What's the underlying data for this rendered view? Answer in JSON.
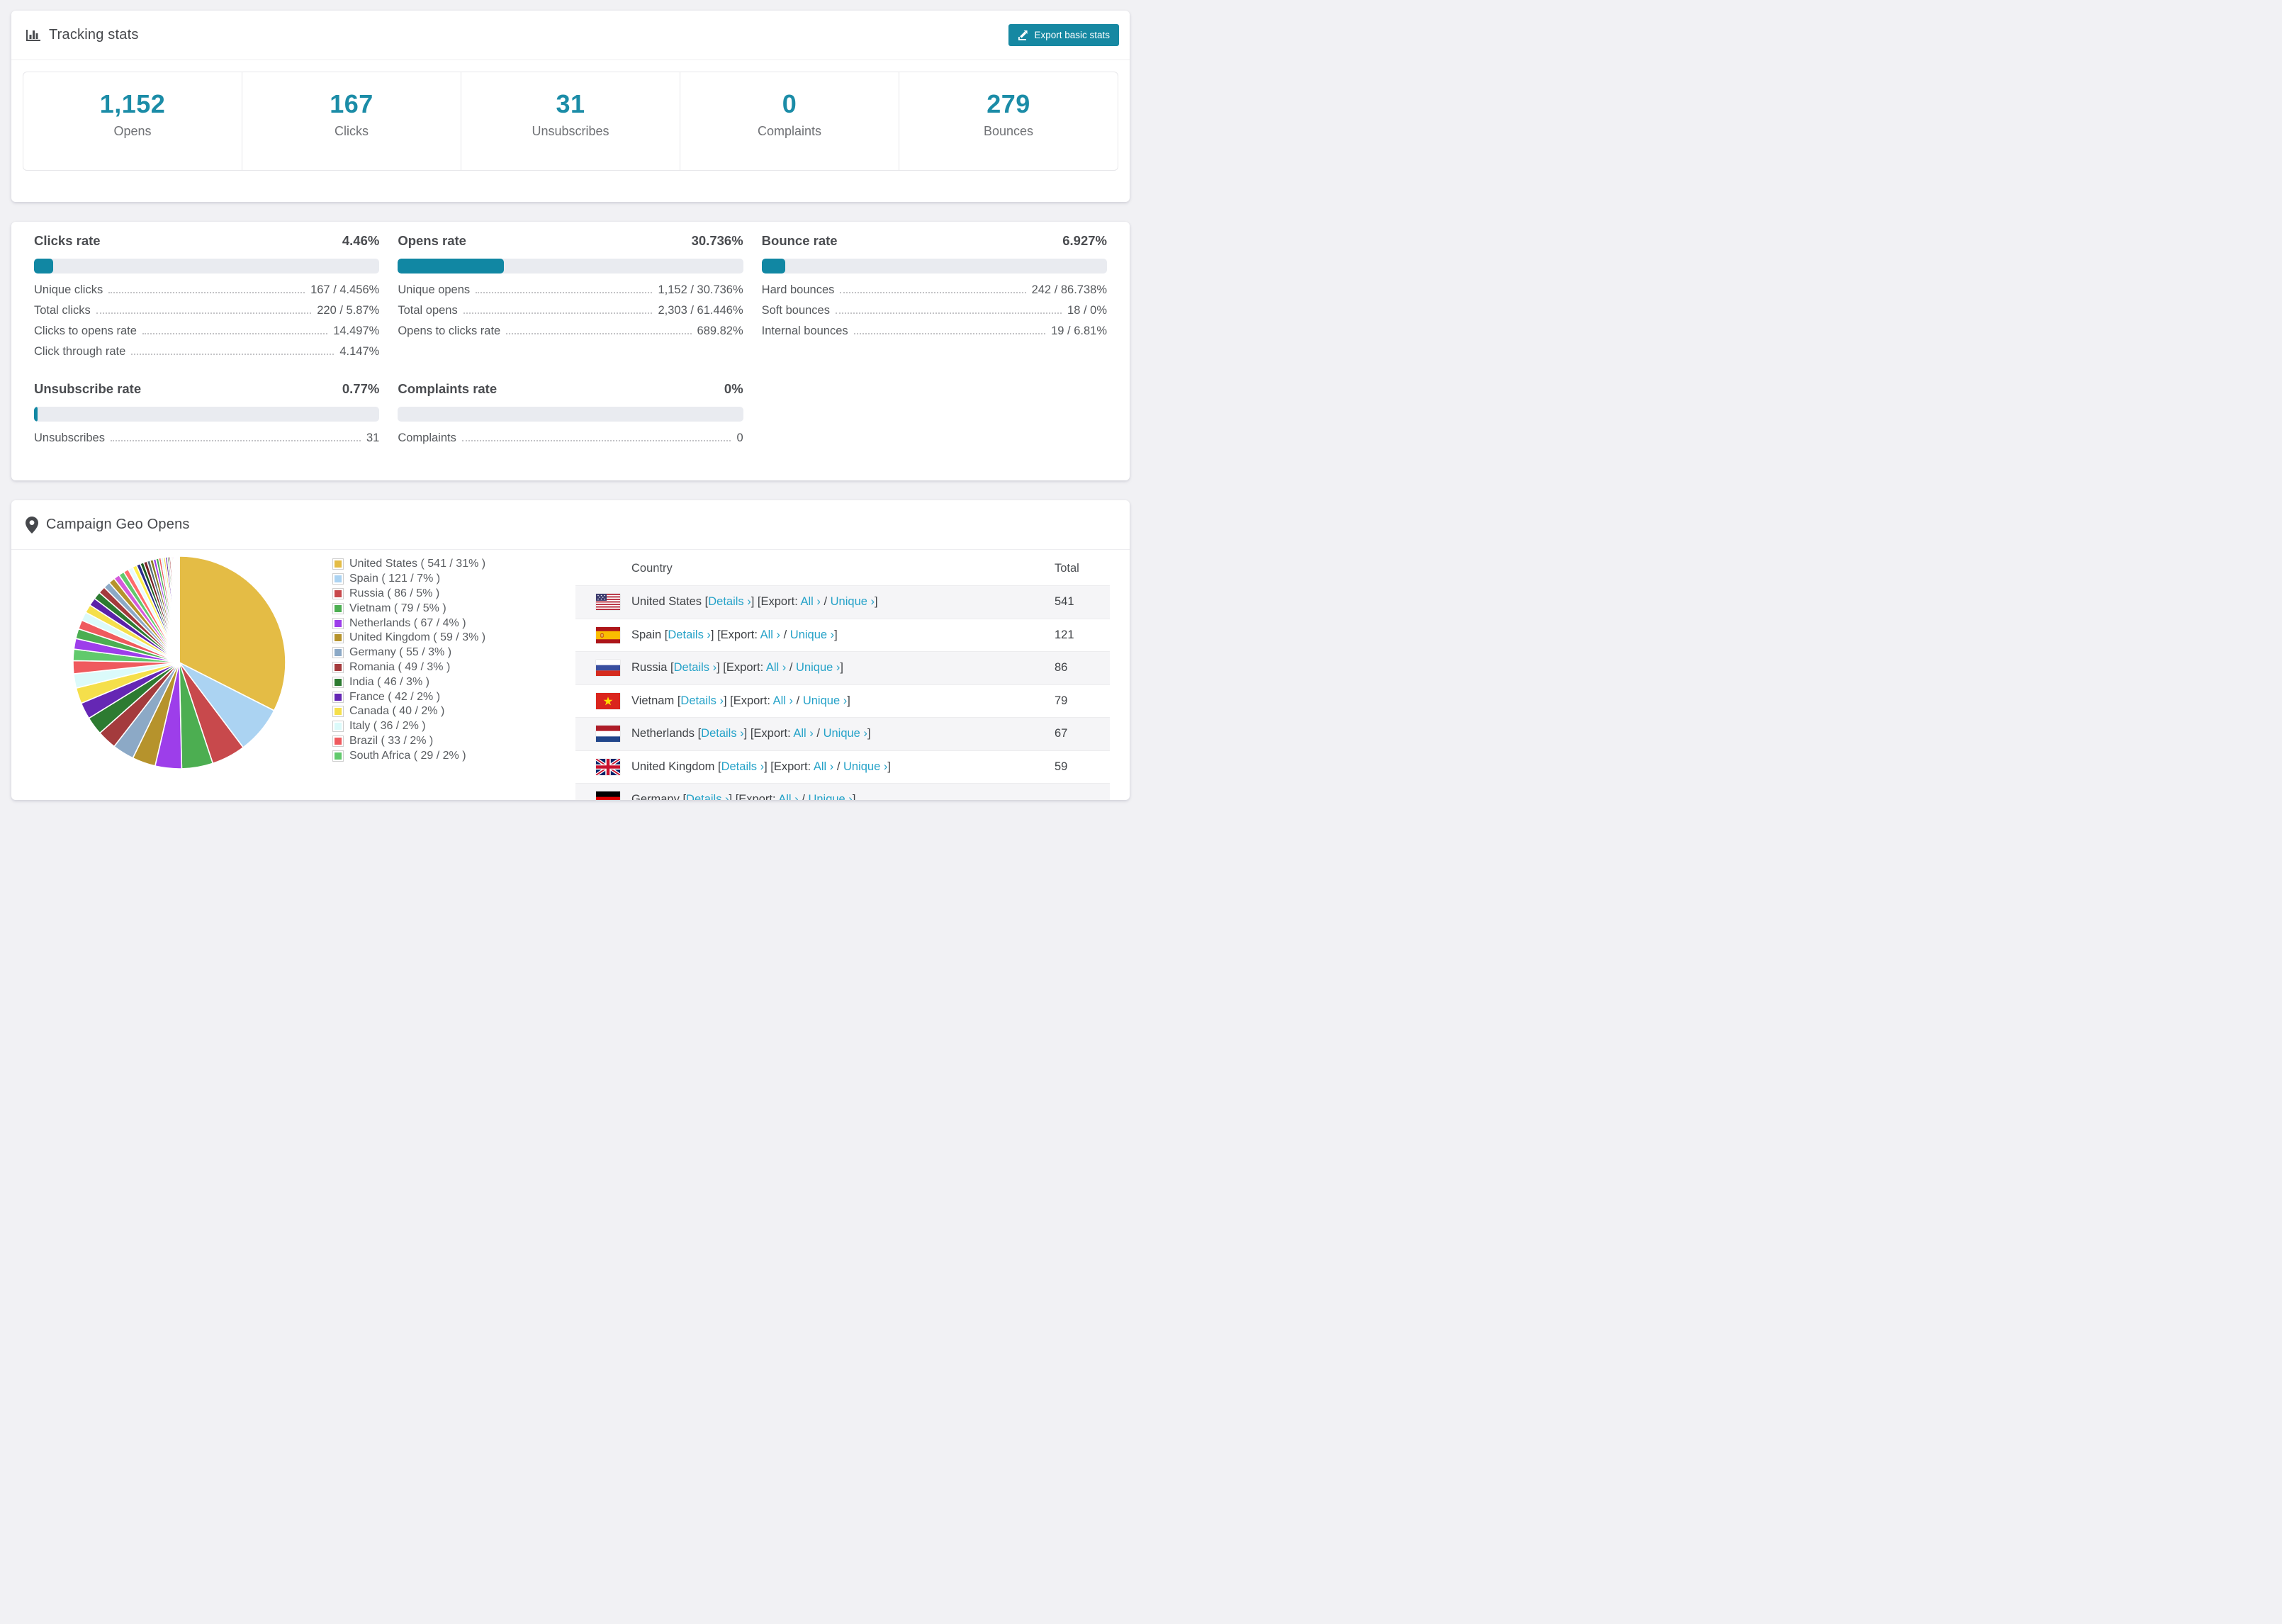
{
  "colors": {
    "accent_teal": "#1688a2",
    "stat_number_teal": "#1b8ca7",
    "link_teal": "#25a2c8",
    "bar_track": "#e9ebf0",
    "page_bg": "#f1f1f4",
    "zebra_row": "#f5f5f7"
  },
  "tracking": {
    "title": "Tracking stats",
    "export_label": "Export basic stats",
    "summary": [
      {
        "value": "1,152",
        "label": "Opens"
      },
      {
        "value": "167",
        "label": "Clicks"
      },
      {
        "value": "31",
        "label": "Unsubscribes"
      },
      {
        "value": "0",
        "label": "Complaints"
      },
      {
        "value": "279",
        "label": "Bounces"
      }
    ]
  },
  "rates": [
    {
      "title": "Clicks rate",
      "value": "4.46%",
      "fill_pct": 5.6,
      "rows": [
        {
          "label": "Unique clicks",
          "value": "167 / 4.456%"
        },
        {
          "label": "Total clicks",
          "value": "220 / 5.87%"
        },
        {
          "label": "Clicks to opens rate",
          "value": "14.497%"
        },
        {
          "label": "Click through rate",
          "value": "4.147%"
        }
      ]
    },
    {
      "title": "Opens rate",
      "value": "30.736%",
      "fill_pct": 30.7,
      "rows": [
        {
          "label": "Unique opens",
          "value": "1,152 / 30.736%"
        },
        {
          "label": "Total opens",
          "value": "2,303 / 61.446%"
        },
        {
          "label": "Opens to clicks rate",
          "value": "689.82%"
        }
      ]
    },
    {
      "title": "Bounce rate",
      "value": "6.927%",
      "fill_pct": 6.9,
      "rows": [
        {
          "label": "Hard bounces",
          "value": "242 / 86.738%"
        },
        {
          "label": "Soft bounces",
          "value": "18 / 0%"
        },
        {
          "label": "Internal bounces",
          "value": "19 / 6.81%"
        }
      ]
    },
    {
      "title": "Unsubscribe rate",
      "value": "0.77%",
      "fill_pct": 0.9,
      "rows": [
        {
          "label": "Unsubscribes",
          "value": "31"
        }
      ]
    },
    {
      "title": "Complaints rate",
      "value": "0%",
      "fill_pct": 0,
      "rows": [
        {
          "label": "Complaints",
          "value": "0"
        }
      ]
    }
  ],
  "geo": {
    "title": "Campaign Geo Opens",
    "table": {
      "col_country": "Country",
      "col_total": "Total",
      "details_label": "Details ›",
      "export_prefix": "[Export:",
      "all_label": "All ›",
      "slash": "/",
      "unique_label": "Unique ›",
      "open_bracket": "[",
      "close_bracket": "]",
      "rows": [
        {
          "country": "United States",
          "flag": "us",
          "total": "541"
        },
        {
          "country": "Spain",
          "flag": "es",
          "total": "121"
        },
        {
          "country": "Russia",
          "flag": "ru",
          "total": "86"
        },
        {
          "country": "Vietnam",
          "flag": "vn",
          "total": "79"
        },
        {
          "country": "Netherlands",
          "flag": "nl",
          "total": "67"
        },
        {
          "country": "United Kingdom",
          "flag": "gb",
          "total": "59"
        },
        {
          "country": "Germany",
          "flag": "de",
          "total": ""
        }
      ]
    }
  },
  "chart_data": {
    "type": "pie",
    "title": "Campaign Geo Opens",
    "legend_position": "right",
    "start_angle_deg": -90,
    "direction": "clockwise",
    "slices": [
      {
        "label": "United States",
        "value": 541,
        "pct": "31%",
        "color": "#E4BC45"
      },
      {
        "label": "Spain",
        "value": 121,
        "pct": "7%",
        "color": "#ABD3F2"
      },
      {
        "label": "Russia",
        "value": 86,
        "pct": "5%",
        "color": "#C8494C"
      },
      {
        "label": "Vietnam",
        "value": 79,
        "pct": "5%",
        "color": "#4CAE51"
      },
      {
        "label": "Netherlands",
        "value": 67,
        "pct": "4%",
        "color": "#9D3EEA"
      },
      {
        "label": "United Kingdom",
        "value": 59,
        "pct": "3%",
        "color": "#B6932C"
      },
      {
        "label": "Germany",
        "value": 55,
        "pct": "3%",
        "color": "#8CA9C6"
      },
      {
        "label": "Romania",
        "value": 49,
        "pct": "3%",
        "color": "#A43B3D"
      },
      {
        "label": "India",
        "value": 46,
        "pct": "3%",
        "color": "#2D7B31"
      },
      {
        "label": "France",
        "value": 42,
        "pct": "2%",
        "color": "#6527B4"
      },
      {
        "label": "Canada",
        "value": 40,
        "pct": "2%",
        "color": "#F5DF4B"
      },
      {
        "label": "Italy",
        "value": 36,
        "pct": "2%",
        "color": "#DBFAFA"
      },
      {
        "label": "Brazil",
        "value": 33,
        "pct": "2%",
        "color": "#EF5A5E"
      },
      {
        "label": "South Africa",
        "value": 29,
        "pct": "2%",
        "color": "#61C96C"
      }
    ],
    "others_values": [
      27,
      25,
      23,
      22,
      21,
      20,
      19,
      18,
      17,
      16,
      15,
      14,
      13,
      12,
      11,
      10,
      9,
      9,
      8,
      8,
      7,
      7,
      6,
      6,
      5,
      5,
      4,
      4,
      3,
      3,
      3,
      2,
      2,
      2,
      2,
      1,
      1,
      1,
      1,
      1
    ],
    "others_palette": [
      "#9D3EEA",
      "#4CAE51",
      "#EF5A5E",
      "#DBFAFA",
      "#F5DF4B",
      "#5B21A8",
      "#2D7B31",
      "#A43B3D",
      "#8CA9C6",
      "#B6932C",
      "#D45BDB",
      "#61C96C",
      "#FF6B6B",
      "#E6FBFF",
      "#FFF04E",
      "#2B2B8A",
      "#1F5C22",
      "#7A2328",
      "#55707F",
      "#8A7C22"
    ],
    "legend_format": "{label} ( {value} / {pct} )"
  }
}
